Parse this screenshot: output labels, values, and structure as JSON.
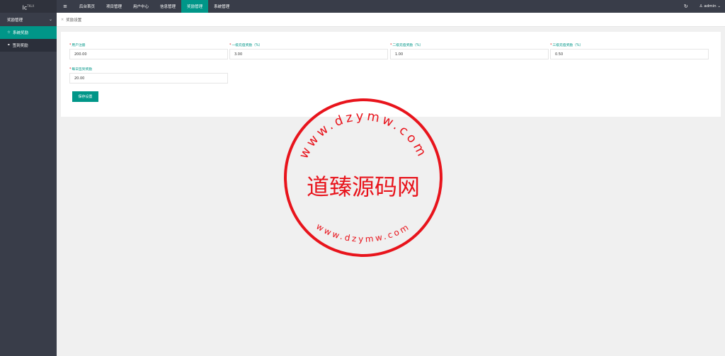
{
  "app": {
    "logo_text": "lc",
    "logo_version": "TKLX"
  },
  "sidebar": {
    "group_label": "奖励管理",
    "items": [
      {
        "label": "系统奖励",
        "active": true
      },
      {
        "label": "签到奖励",
        "active": false
      }
    ]
  },
  "topbar": {
    "menu_icon": "≡",
    "nav": [
      {
        "label": "后台首页"
      },
      {
        "label": "项目管理"
      },
      {
        "label": "用户中心"
      },
      {
        "label": "信息管理"
      },
      {
        "label": "奖励管理",
        "active": true
      },
      {
        "label": "系统管理"
      }
    ],
    "username": "admin"
  },
  "tab": {
    "label": "奖励设置"
  },
  "form": {
    "fields": [
      {
        "label": "用户注册",
        "value": "200.00"
      },
      {
        "label": "一级充值奖励（%）",
        "value": "3.00"
      },
      {
        "label": "二级充值奖励（%）",
        "value": "1.00"
      },
      {
        "label": "三级充值奖励（%）",
        "value": "0.50"
      },
      {
        "label": "每日签到奖励",
        "value": "20.00"
      }
    ],
    "save_label": "保存设置"
  },
  "watermark": {
    "center_text": "道臻源码网",
    "ring_text": "www.dzymw.com",
    "color": "#e8141c"
  },
  "colors": {
    "accent": "#009688",
    "dark": "#393d49"
  }
}
